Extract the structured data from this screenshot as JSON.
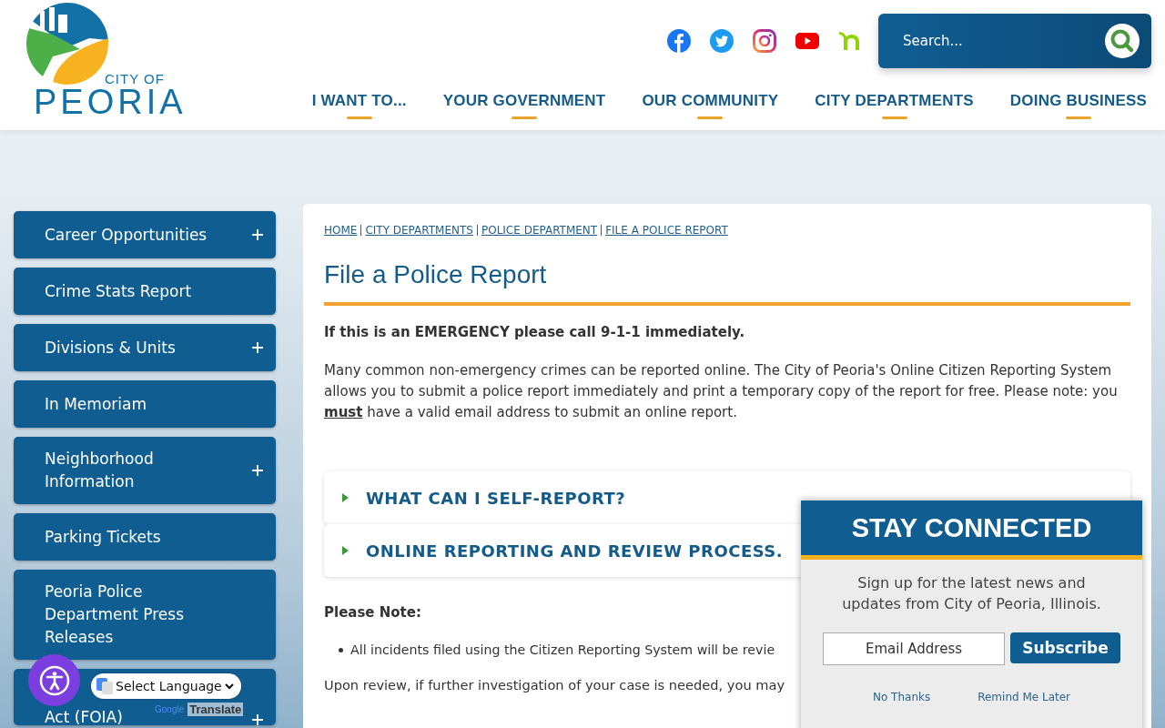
{
  "logo": {
    "line_1": "CITY OF",
    "line_2": "PEORIA"
  },
  "social": [
    {
      "kind": "facebook"
    },
    {
      "kind": "twitter"
    },
    {
      "kind": "instagram"
    },
    {
      "kind": "youtube"
    },
    {
      "kind": "nextdoor"
    }
  ],
  "search": {
    "placeholder": "Search..."
  },
  "nav": [
    {
      "label": "I WANT TO..."
    },
    {
      "label": "YOUR GOVERNMENT"
    },
    {
      "label": "OUR COMMUNITY"
    },
    {
      "label": "CITY DEPARTMENTS"
    },
    {
      "label": "DOING BUSINESS"
    }
  ],
  "sidebar": {
    "items": [
      {
        "label": "Career Opportunities",
        "expandable": true
      },
      {
        "label": "Crime Stats Report",
        "expandable": false
      },
      {
        "label": "Divisions & Units",
        "expandable": true
      },
      {
        "label": "In Memoriam",
        "expandable": false
      },
      {
        "label": "Neighborhood Information",
        "expandable": true
      },
      {
        "label": "Parking Tickets",
        "expandable": false
      },
      {
        "label": "Peoria Police Department Press Releases",
        "expandable": false
      },
      {
        "label": "Act (FOIA)",
        "expandable": true
      }
    ]
  },
  "breadcrumb": [
    "HOME",
    "CITY DEPARTMENTS",
    "POLICE DEPARTMENT",
    "FILE A POLICE REPORT"
  ],
  "page_title": "File a Police Report",
  "emergency_note": "If this is an EMERGENCY please call 9-1-1 immediately.",
  "intro": "Many common non-emergency crimes can be reported online. The City of Peoria's Online Citizen Reporting System allows you to submit a police report immediately and print a temporary copy of the report for free. Please note: you **must** have a valid email address to submit an online report.",
  "accordion": [
    {
      "title": "WHAT CAN I SELF-REPORT?",
      "expanded": false
    },
    {
      "title": "ONLINE REPORTING AND REVIEW PROCESS.",
      "expanded": false
    }
  ],
  "please_note": "Please Note:",
  "bullets": [
    "All incidents filed using the Citizen Reporting System will be revie"
  ],
  "review_text": "Upon review, if further investigation of your case is needed, you may",
  "translate": {
    "select": "Select Language",
    "brand": "Google",
    "label": "Translate"
  },
  "popup": {
    "title": "STAY CONNECTED",
    "text": "Sign up for the latest news and updates from City of Peoria, Illinois.",
    "email_placeholder": "Email Address",
    "subscribe": "Subscribe",
    "no_thanks": "No Thanks",
    "remind": "Remind Me Later"
  }
}
